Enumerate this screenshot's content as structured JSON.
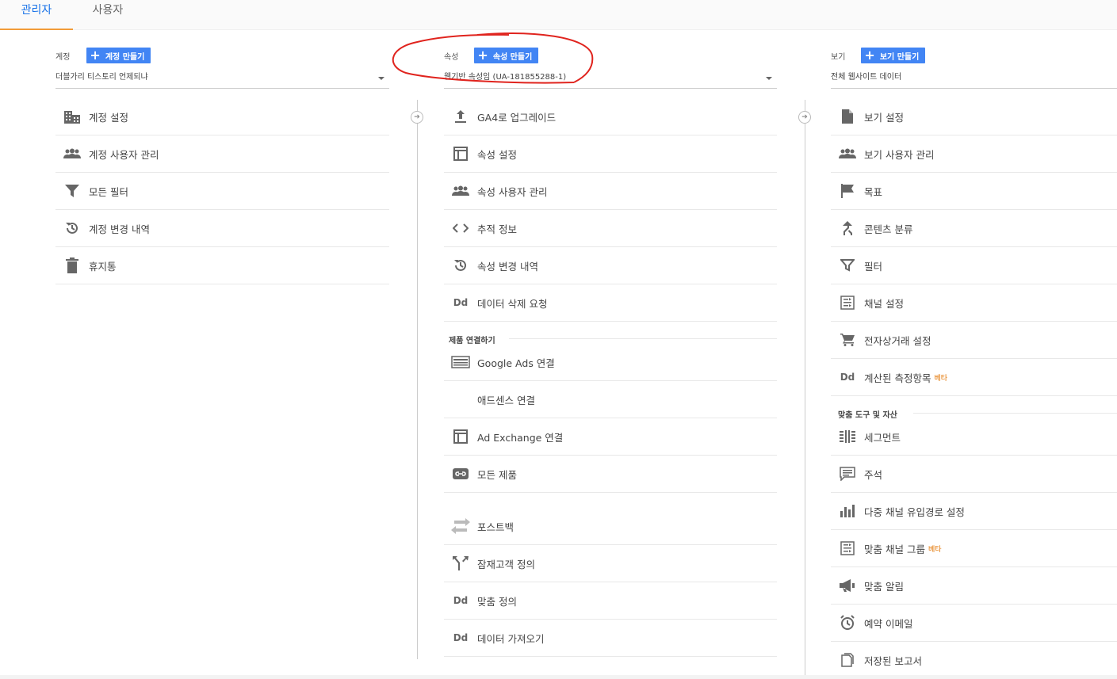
{
  "tabs": [
    {
      "label": "관리자",
      "active": true
    },
    {
      "label": "사용자",
      "active": false
    }
  ],
  "account": {
    "label": "계정",
    "create_label": "계정 만들기",
    "selected": "더블가리 티스토리 언제되냐",
    "items": [
      {
        "label": "계정 설정",
        "icon": "building-icon"
      },
      {
        "label": "계정 사용자 관리",
        "icon": "people-icon"
      },
      {
        "label": "모든 필터",
        "icon": "filter-icon"
      },
      {
        "label": "계정 변경 내역",
        "icon": "history-icon"
      },
      {
        "label": "휴지통",
        "icon": "trash-icon"
      }
    ]
  },
  "property": {
    "label": "속성",
    "create_label": "속성 만들기",
    "selected": "웹기반 속성임 (UA-181855288-1)",
    "items": [
      {
        "label": "GA4로 업그레이드",
        "icon": "upload-icon"
      },
      {
        "label": "속성 설정",
        "icon": "layout-icon"
      },
      {
        "label": "속성 사용자 관리",
        "icon": "people-icon"
      },
      {
        "label": "추적 정보",
        "icon": "code-icon"
      },
      {
        "label": "속성 변경 내역",
        "icon": "history-icon"
      },
      {
        "label": "데이터 삭제 요청",
        "icon": "dd-icon"
      }
    ],
    "section_title": "제품 연결하기",
    "product_items": [
      {
        "label": "Google Ads 연결",
        "icon": "ads-icon"
      },
      {
        "label": "애드센스 연결",
        "icon": ""
      },
      {
        "label": "Ad Exchange 연결",
        "icon": "layout-icon"
      },
      {
        "label": "모든 제품",
        "icon": "link-icon"
      }
    ],
    "more_items": [
      {
        "label": "포스트백",
        "icon": "swap-icon"
      },
      {
        "label": "잠재고객 정의",
        "icon": "fork-icon"
      },
      {
        "label": "맞춤 정의",
        "icon": "dd-icon"
      },
      {
        "label": "데이터 가져오기",
        "icon": "dd-icon"
      }
    ]
  },
  "view": {
    "label": "보기",
    "create_label": "보기 만들기",
    "selected": "전체 웹사이트 데이터",
    "items": [
      {
        "label": "보기 설정",
        "icon": "document-icon"
      },
      {
        "label": "보기 사용자 관리",
        "icon": "people-icon"
      },
      {
        "label": "목표",
        "icon": "flag-icon"
      },
      {
        "label": "콘텐츠 분류",
        "icon": "merge-icon"
      },
      {
        "label": "필터",
        "icon": "filter-icon"
      },
      {
        "label": "채널 설정",
        "icon": "channel-icon"
      },
      {
        "label": "전자상거래 설정",
        "icon": "cart-icon"
      },
      {
        "label": "계산된 측정항목",
        "icon": "dd-icon",
        "beta": "베타"
      }
    ],
    "section_title": "맞춤 도구 및 자산",
    "tool_items": [
      {
        "label": "세그먼트",
        "icon": "segment-icon"
      },
      {
        "label": "주석",
        "icon": "comment-icon"
      },
      {
        "label": "다중 채널 유입경로 설정",
        "icon": "bars-icon"
      },
      {
        "label": "맞춤 채널 그룹",
        "icon": "channel-icon",
        "beta": "베타"
      },
      {
        "label": "맞춤 알림",
        "icon": "megaphone-icon"
      },
      {
        "label": "예약 이메일",
        "icon": "alarm-icon"
      },
      {
        "label": "저장된 보고서",
        "icon": "copy-icon"
      }
    ]
  }
}
